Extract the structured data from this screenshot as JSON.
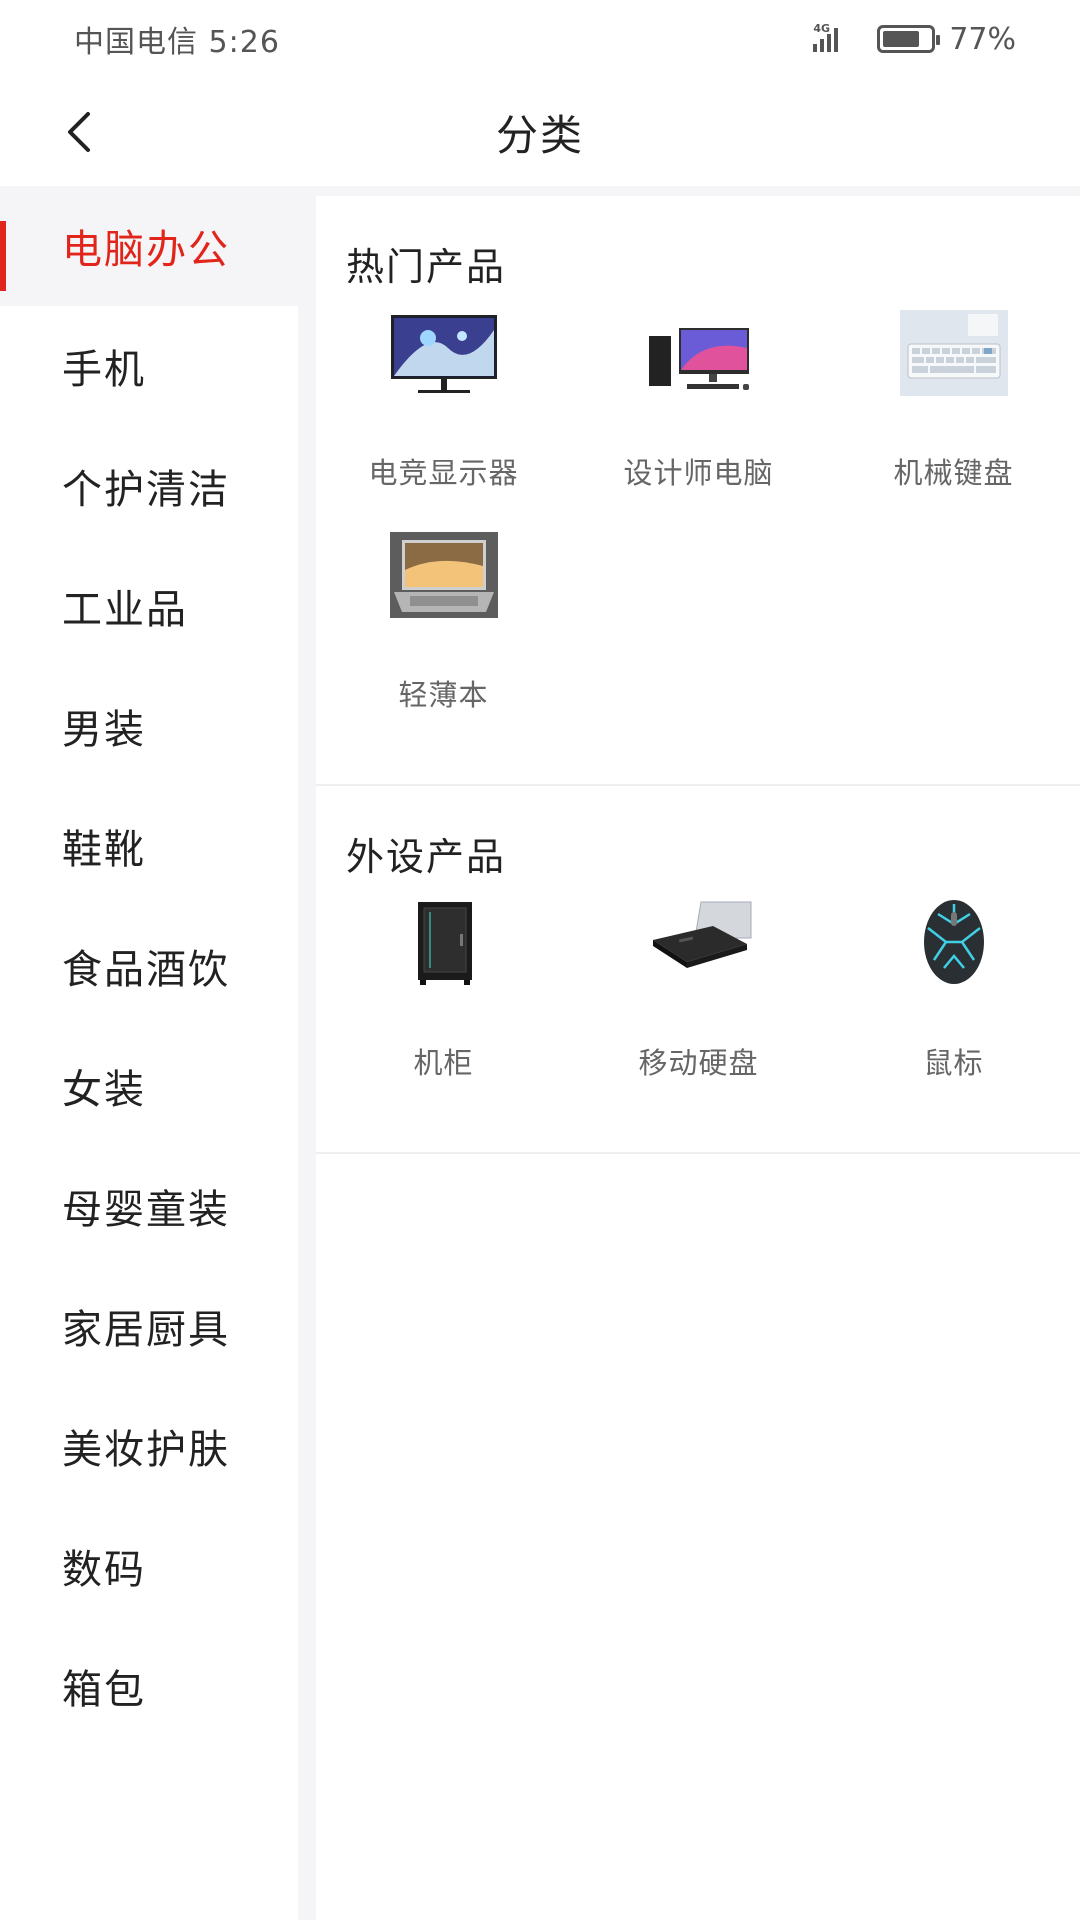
{
  "status_bar": {
    "carrier_time": "中国电信 5:26",
    "network": "4G",
    "battery": "77%",
    "battery_level": 0.77
  },
  "header": {
    "title": "分类"
  },
  "sidebar": {
    "items": [
      {
        "label": "电脑办公",
        "active": true
      },
      {
        "label": "手机"
      },
      {
        "label": "个护清洁"
      },
      {
        "label": "工业品"
      },
      {
        "label": "男装"
      },
      {
        "label": "鞋靴"
      },
      {
        "label": "食品酒饮"
      },
      {
        "label": "女装"
      },
      {
        "label": "母婴童装"
      },
      {
        "label": "家居厨具"
      },
      {
        "label": "美妆护肤"
      },
      {
        "label": "数码"
      },
      {
        "label": "箱包"
      }
    ]
  },
  "sections": [
    {
      "title": "热门产品",
      "products": [
        {
          "label": "电竞显示器",
          "icon": "monitor-icon"
        },
        {
          "label": "设计师电脑",
          "icon": "desktop-computer-icon"
        },
        {
          "label": "机械键盘",
          "icon": "keyboard-icon"
        },
        {
          "label": "轻薄本",
          "icon": "laptop-icon"
        }
      ]
    },
    {
      "title": "外设产品",
      "products": [
        {
          "label": "机柜",
          "icon": "server-cabinet-icon"
        },
        {
          "label": "移动硬盘",
          "icon": "hard-drive-icon"
        },
        {
          "label": "鼠标",
          "icon": "mouse-icon"
        }
      ]
    }
  ],
  "colors": {
    "accent": "#e1251b",
    "background": "#f5f5f7"
  }
}
